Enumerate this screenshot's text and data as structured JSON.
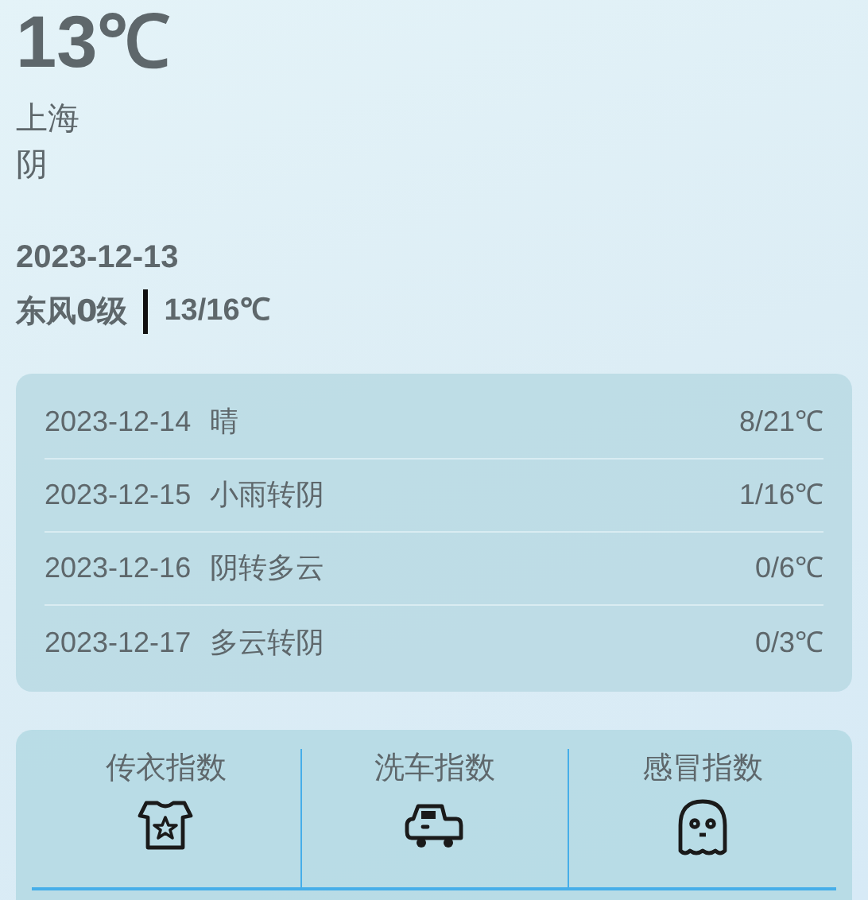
{
  "current": {
    "temperature": "13℃",
    "city": "上海",
    "condition": "阴",
    "date": "2023-12-13",
    "wind": "东风0级",
    "range": "13/16℃"
  },
  "forecast": [
    {
      "date": "2023-12-14",
      "condition": "晴",
      "range": "8/21℃"
    },
    {
      "date": "2023-12-15",
      "condition": "小雨转阴",
      "range": "1/16℃"
    },
    {
      "date": "2023-12-16",
      "condition": "阴转多云",
      "range": "0/6℃"
    },
    {
      "date": "2023-12-17",
      "condition": "多云转阴",
      "range": "0/3℃"
    }
  ],
  "indices": [
    {
      "label": "传衣指数",
      "kind": "clothing"
    },
    {
      "label": "洗车指数",
      "kind": "car"
    },
    {
      "label": "感冒指数",
      "kind": "ghost"
    }
  ]
}
